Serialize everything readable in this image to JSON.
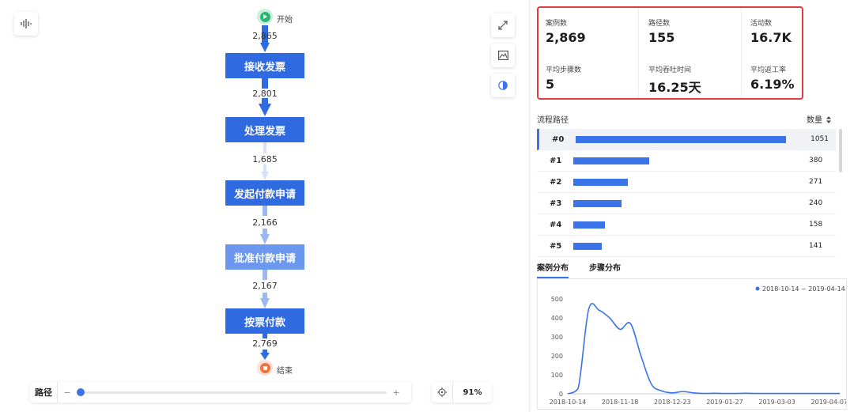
{
  "canvas": {
    "start_label": "开始",
    "end_label": "结束",
    "nodes": [
      {
        "label": "接收发票",
        "color": "#2f6ae0"
      },
      {
        "label": "处理发票",
        "color": "#2f6ae0"
      },
      {
        "label": "发起付款申请",
        "color": "#2f6ae0"
      },
      {
        "label": "批准付款申请",
        "color": "#6b98ee"
      },
      {
        "label": "按票付款",
        "color": "#2f6ae0"
      }
    ],
    "edges": [
      "2,865",
      "2,801",
      "1,685",
      "2,166",
      "2,167",
      "2,769"
    ],
    "path_label": "路径",
    "minus": "−",
    "plus": "+",
    "path_level": 0.0,
    "zoom": "91%"
  },
  "stats": [
    {
      "title": "案例数",
      "value": "2,869"
    },
    {
      "title": "路径数",
      "value": "155"
    },
    {
      "title": "活动数",
      "value": "16.7K"
    },
    {
      "title": "平均步骤数",
      "value": "5"
    },
    {
      "title": "平均吞吐时间",
      "value": "16.25天"
    },
    {
      "title": "平均返工率",
      "value": "6.19%"
    }
  ],
  "paths": {
    "header_name": "流程路径",
    "header_count": "数量",
    "sort_icon": "sort-icon",
    "max": 1051,
    "rows": [
      {
        "id": "#0",
        "count": 1051
      },
      {
        "id": "#1",
        "count": 380
      },
      {
        "id": "#2",
        "count": 271
      },
      {
        "id": "#3",
        "count": 240
      },
      {
        "id": "#4",
        "count": 158
      },
      {
        "id": "#5",
        "count": 141
      }
    ]
  },
  "tabs": [
    "案例分布",
    "步骤分布"
  ],
  "colors": {
    "accent": "#3b74e8",
    "highlight": "#e23b3b",
    "start": "#2bb673",
    "end": "#f0703f"
  },
  "chart_data": {
    "type": "line",
    "legend": "2018-10-14 ~ 2019-04-14",
    "legend_position": "top-right",
    "ylim": [
      0,
      500
    ],
    "yticks": [
      0,
      100,
      200,
      300,
      400,
      500
    ],
    "xticks": [
      "2018-10-14",
      "2018-11-18",
      "2018-12-23",
      "2019-01-27",
      "2019-03-03",
      "2019-04-07"
    ],
    "x": [
      "2018-10-14",
      "2018-10-21",
      "2018-10-28",
      "2018-11-04",
      "2018-11-11",
      "2018-11-18",
      "2018-11-25",
      "2018-12-02",
      "2018-12-09",
      "2018-12-16",
      "2018-12-23",
      "2018-12-30",
      "2019-01-06",
      "2019-01-13",
      "2019-01-20",
      "2019-01-27",
      "2019-02-03",
      "2019-02-10",
      "2019-02-17",
      "2019-02-24",
      "2019-03-03",
      "2019-03-10",
      "2019-03-17",
      "2019-03-24",
      "2019-03-31",
      "2019-04-07",
      "2019-04-14"
    ],
    "values": [
      0,
      30,
      445,
      440,
      400,
      340,
      370,
      200,
      50,
      15,
      5,
      12,
      5,
      2,
      3,
      2,
      2,
      3,
      2,
      2,
      2,
      2,
      2,
      2,
      2,
      2,
      2
    ]
  }
}
